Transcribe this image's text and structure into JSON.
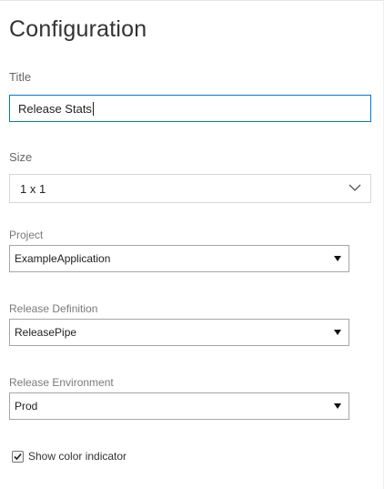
{
  "panel": {
    "title": "Configuration"
  },
  "title_field": {
    "label": "Title",
    "value": "Release Stats"
  },
  "size_field": {
    "label": "Size",
    "value": "1 x 1"
  },
  "project_field": {
    "label": "Project",
    "value": "ExampleApplication"
  },
  "release_definition_field": {
    "label": "Release Definition",
    "value": "ReleasePipe"
  },
  "release_environment_field": {
    "label": "Release Environment",
    "value": "Prod"
  },
  "color_indicator": {
    "label": "Show color indicator",
    "checked": true
  },
  "colors": {
    "focus_border": "#0078d4"
  }
}
